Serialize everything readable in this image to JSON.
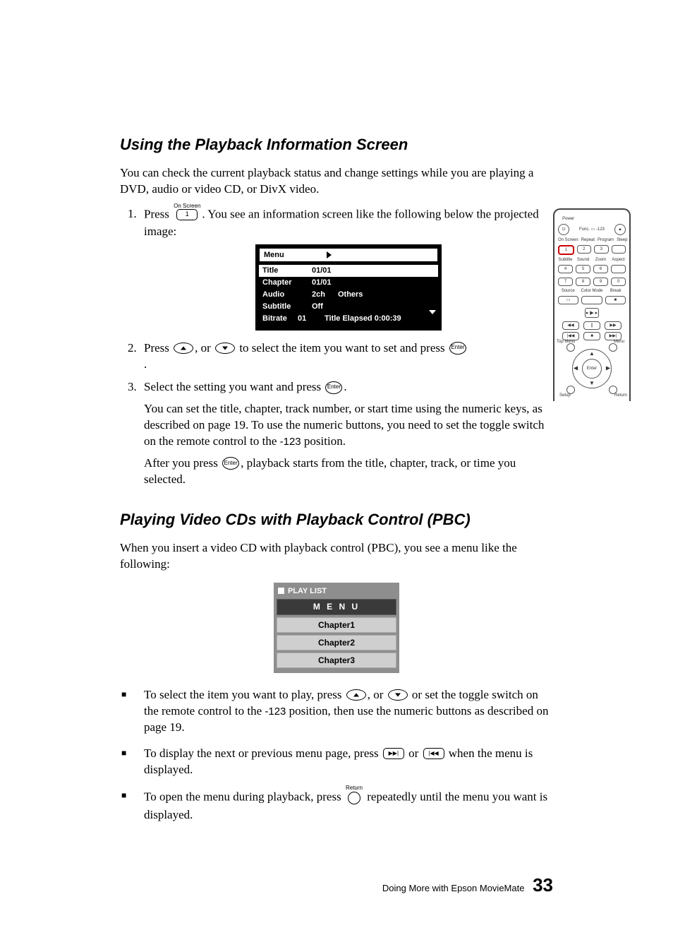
{
  "section1": {
    "title": "Using the Playback Information Screen",
    "intro": "You can check the current playback status and change settings while you are playing a DVD, audio or video CD, or DivX video.",
    "step1_a": "Press ",
    "step1_key_label": "On Screen",
    "step1_key_value": "1",
    "step1_b": ". You see an information screen like the following below the projected image:",
    "osd": {
      "menu": "Menu",
      "rows": {
        "title_k": "Title",
        "title_v": "01/01",
        "chapter_k": "Chapter",
        "chapter_v": "01/01",
        "audio_k": "Audio",
        "audio_v": "2ch",
        "audio_v2": "Others",
        "subtitle_k": "Subtitle",
        "subtitle_v": "Off",
        "bitrate_k": "Bitrate",
        "bitrate_mid": "01",
        "bitrate_v": "Title Elapsed  0:00:39"
      }
    },
    "step2_a": "Press ",
    "step2_mid": ", or ",
    "step2_b": " to select the item you want to set and press ",
    "enter_label": "Enter",
    "step2_c": ".",
    "step3_a": "Select the setting you want and press ",
    "step3_b": ".",
    "step3_note1": "You can set the title, chapter, track number, or start time using the numeric keys, as described on page 19. To use the numeric buttons, you need to set the toggle switch on the remote control to the ",
    "toggle_code": "-123",
    "step3_note1b": " position.",
    "step3_note2a": "After you press ",
    "step3_note2b": ", playback starts from the title, chapter, track, or time you selected."
  },
  "remote": {
    "power": "Power",
    "func_toggle": "Func. ▭ -123",
    "eject": "▲",
    "row2": [
      "On Screen",
      "Repeat",
      "Program",
      "Sleep"
    ],
    "keys2": [
      "1",
      "2",
      "3",
      ""
    ],
    "row3": [
      "Subtitle",
      "Sound",
      "Zoom",
      "Aspect"
    ],
    "keys3": [
      "4",
      "5",
      "6",
      ""
    ],
    "keys4": [
      "7",
      "8",
      "9",
      "0"
    ],
    "row5": [
      "Source",
      "Color Mode",
      "Break"
    ],
    "keys5": [
      "▭",
      "",
      "■"
    ],
    "play_center": "▶",
    "trans1": [
      "◀◀",
      "||",
      "▶▶"
    ],
    "trans2": [
      "|◀◀",
      "■",
      "▶▶|"
    ],
    "corners": {
      "tl": "Top Menu",
      "tr": "Menu",
      "bl": "Setup",
      "br": "Return"
    },
    "dpad_center": "Enter"
  },
  "section2": {
    "title": "Playing Video CDs with Playback Control (PBC)",
    "intro": "When you insert a video CD with playback control (PBC), you see a menu like the following:",
    "pbc": {
      "header": "PLAY LIST",
      "menu": "M E N U",
      "items": [
        "Chapter1",
        "Chapter2",
        "Chapter3"
      ]
    },
    "b1_a": "To select the item you want to play, press ",
    "b1_mid": ", or ",
    "b1_b": " or set the toggle switch on the remote control to the ",
    "b1_c": " position, then use the numeric buttons as described on page 19.",
    "b2_a": "To display the next or previous menu page, press ",
    "b2_mid": " or ",
    "b2_b": " when the menu is displayed.",
    "b2_next": "▶▶|",
    "b2_prev": "|◀◀",
    "b3_a": "To open the menu during playback, press ",
    "b3_key_label": "Return",
    "b3_b": " repeatedly until the menu you want is displayed."
  },
  "footer": {
    "text": "Doing More with Epson MovieMate",
    "page": "33"
  }
}
